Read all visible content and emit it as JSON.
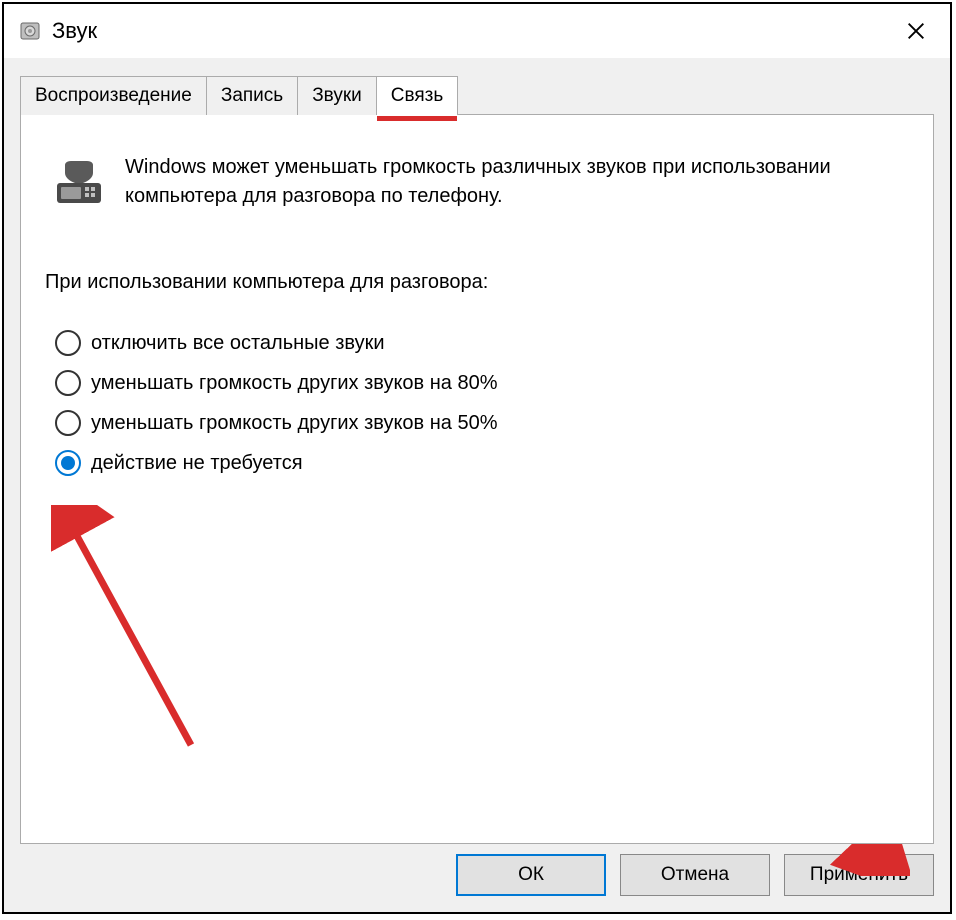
{
  "window": {
    "title": "Звук"
  },
  "tabs": [
    {
      "label": "Воспроизведение",
      "active": false
    },
    {
      "label": "Запись",
      "active": false
    },
    {
      "label": "Звуки",
      "active": false
    },
    {
      "label": "Связь",
      "active": true
    }
  ],
  "panel": {
    "intro": "Windows может уменьшать громкость различных звуков при использовании компьютера для разговора по телефону.",
    "heading": "При использовании компьютера для разговора:",
    "options": [
      {
        "label": "отключить все остальные звуки",
        "selected": false
      },
      {
        "label": "уменьшать громкость других звуков на 80%",
        "selected": false
      },
      {
        "label": "уменьшать громкость других звуков на 50%",
        "selected": false
      },
      {
        "label": "действие не требуется",
        "selected": true
      }
    ]
  },
  "buttons": {
    "ok": "ОК",
    "cancel": "Отмена",
    "apply": "Применить"
  }
}
